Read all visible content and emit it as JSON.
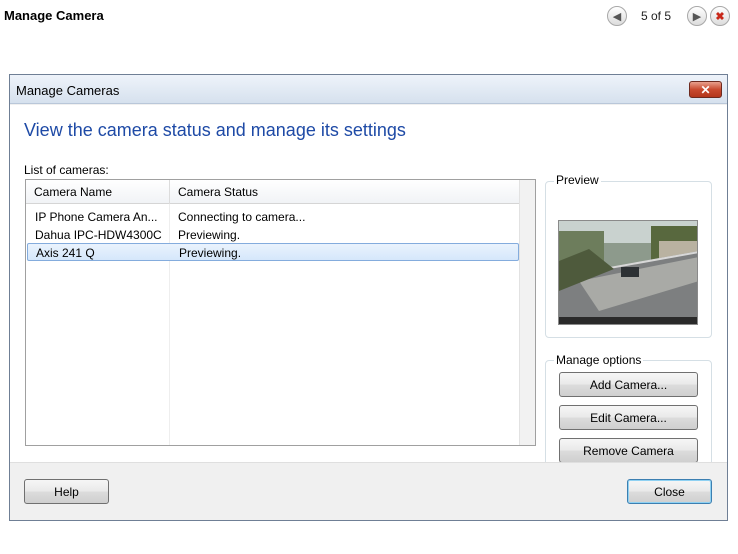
{
  "header": {
    "title": "Manage Camera",
    "page_counter": "5 of 5",
    "prev_icon": "arrow-left-icon",
    "next_icon": "arrow-right-icon",
    "close_icon": "close-icon"
  },
  "dialog": {
    "title": "Manage Cameras",
    "heading": "View the camera status and manage its settings",
    "list_label": "List of cameras:",
    "columns": [
      "Camera Name",
      "Camera Status"
    ],
    "rows": [
      {
        "name": "IP Phone Camera An...",
        "status": "Connecting to camera...",
        "selected": false
      },
      {
        "name": "Dahua IPC-HDW4300C",
        "status": "Previewing.",
        "selected": false
      },
      {
        "name": "Axis 241 Q",
        "status": "Previewing.",
        "selected": true
      }
    ],
    "preview_label": "Preview",
    "manage_options_label": "Manage options",
    "buttons": {
      "add": "Add Camera...",
      "edit": "Edit Camera...",
      "remove": "Remove Camera",
      "help": "Help",
      "close": "Close"
    },
    "colors": {
      "heading": "#1e4aa6",
      "close_button": "#c94a2f",
      "selection": "#d5e7fb"
    }
  }
}
